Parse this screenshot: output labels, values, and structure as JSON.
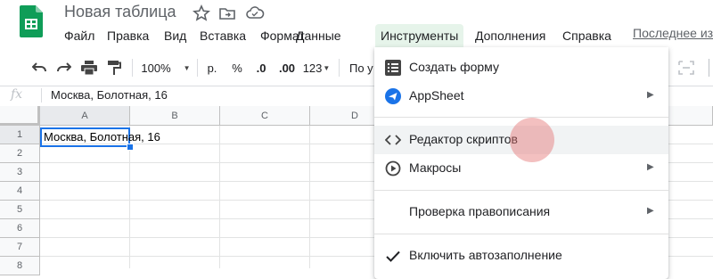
{
  "document": {
    "title": "Новая таблица",
    "last_edit": "Последнее из"
  },
  "menu": {
    "items": [
      "Файл",
      "Правка",
      "Вид",
      "Вставка",
      "Формат",
      "Данные",
      "Инструменты",
      "Дополнения",
      "Справка"
    ],
    "active": "Инструменты"
  },
  "toolbar": {
    "zoom": "100%",
    "currency": "р.",
    "percent": "%",
    "decimal_decrease": ".0",
    "decimal_increase": ".00",
    "format_more": "123",
    "font_partial": "По у"
  },
  "formula_bar": {
    "fx_label": "fx",
    "value": "Москва, Болотная, 16"
  },
  "grid": {
    "columns": [
      "A",
      "B",
      "C",
      "D"
    ],
    "rows": [
      "1",
      "2",
      "3",
      "4",
      "5",
      "6",
      "7",
      "8"
    ],
    "selected_column": "A",
    "selected_row": "1",
    "a1_value": "Москва, Болотная, 16"
  },
  "tools_menu": {
    "items": [
      {
        "label": "Создать форму",
        "icon": "form-icon",
        "submenu": false
      },
      {
        "label": "AppSheet",
        "icon": "appsheet-icon",
        "submenu": true
      },
      {
        "label": "Редактор скриптов",
        "icon": "code-icon",
        "submenu": false
      },
      {
        "label": "Макросы",
        "icon": "macros-play-icon",
        "submenu": true
      },
      {
        "label": "Проверка правописания",
        "icon": "",
        "submenu": true
      },
      {
        "label": "Включить автозаполнение",
        "icon": "checkmark-icon",
        "submenu": false
      }
    ],
    "hovered": "Редактор скриптов"
  },
  "colors": {
    "accent_blue": "#1a73e8",
    "sheets_green": "#0f9d58",
    "menu_active_bg": "#e6f4ea",
    "click_ripple": "#e57373"
  }
}
